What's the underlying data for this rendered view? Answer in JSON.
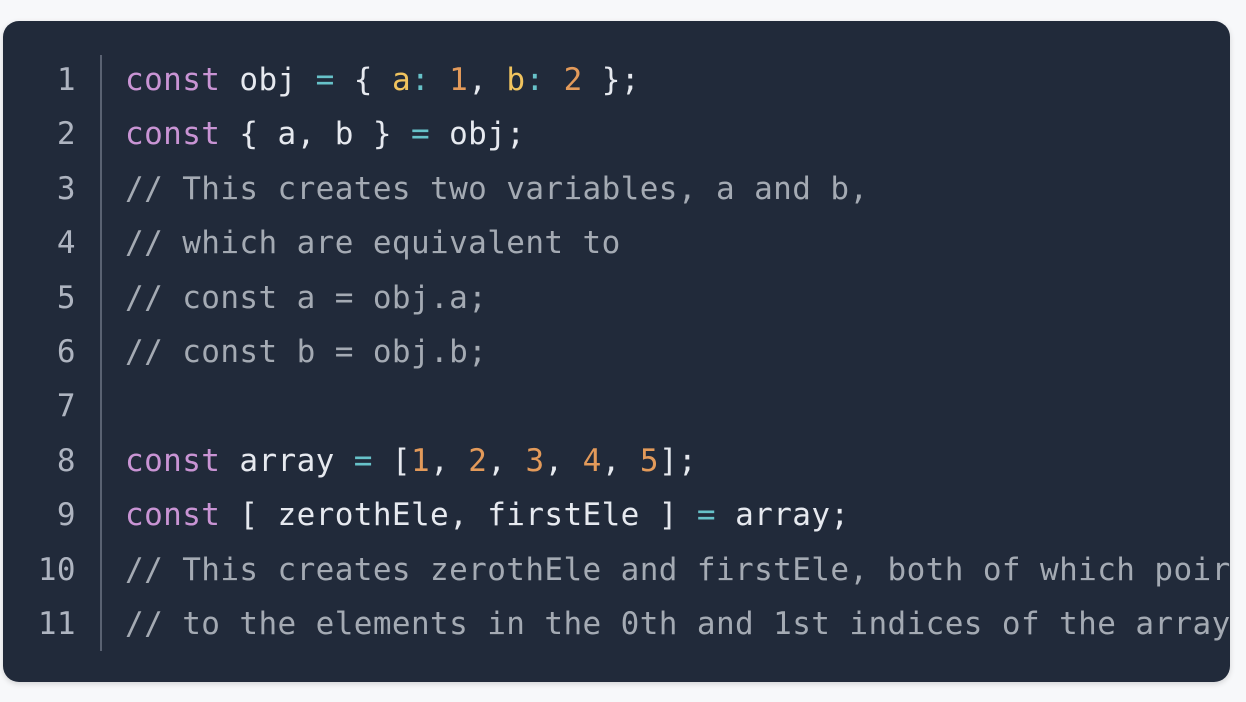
{
  "code_block": {
    "language": "javascript",
    "colors": {
      "background": "#212a3a",
      "keyword": "#c994d4",
      "operator": "#67c2c9",
      "number": "#e39a5a",
      "property": "#f0c35e",
      "comment": "#a4aab3",
      "text": "#e6e9ef",
      "line_number": "#aeb4c0"
    },
    "lines": [
      {
        "number": "1",
        "tokens": [
          {
            "t": "const",
            "c": "kw"
          },
          {
            "t": " obj ",
            "c": "pl"
          },
          {
            "t": "=",
            "c": "op"
          },
          {
            "t": " { ",
            "c": "pl"
          },
          {
            "t": "a",
            "c": "prop"
          },
          {
            "t": ":",
            "c": "op"
          },
          {
            "t": " ",
            "c": "pl"
          },
          {
            "t": "1",
            "c": "num"
          },
          {
            "t": ", ",
            "c": "pl"
          },
          {
            "t": "b",
            "c": "prop"
          },
          {
            "t": ":",
            "c": "op"
          },
          {
            "t": " ",
            "c": "pl"
          },
          {
            "t": "2",
            "c": "num"
          },
          {
            "t": " };",
            "c": "pl"
          }
        ]
      },
      {
        "number": "2",
        "tokens": [
          {
            "t": "const",
            "c": "kw"
          },
          {
            "t": " { a, b } ",
            "c": "pl"
          },
          {
            "t": "=",
            "c": "op"
          },
          {
            "t": " obj;",
            "c": "pl"
          }
        ]
      },
      {
        "number": "3",
        "tokens": [
          {
            "t": "// This creates two variables, a and b,",
            "c": "cm"
          }
        ]
      },
      {
        "number": "4",
        "tokens": [
          {
            "t": "// which are equivalent to",
            "c": "cm"
          }
        ]
      },
      {
        "number": "5",
        "tokens": [
          {
            "t": "// const a = obj.a;",
            "c": "cm"
          }
        ]
      },
      {
        "number": "6",
        "tokens": [
          {
            "t": "// const b = obj.b;",
            "c": "cm"
          }
        ]
      },
      {
        "number": "7",
        "tokens": []
      },
      {
        "number": "8",
        "tokens": [
          {
            "t": "const",
            "c": "kw"
          },
          {
            "t": " array ",
            "c": "pl"
          },
          {
            "t": "=",
            "c": "op"
          },
          {
            "t": " [",
            "c": "pl"
          },
          {
            "t": "1",
            "c": "num"
          },
          {
            "t": ", ",
            "c": "pl"
          },
          {
            "t": "2",
            "c": "num"
          },
          {
            "t": ", ",
            "c": "pl"
          },
          {
            "t": "3",
            "c": "num"
          },
          {
            "t": ", ",
            "c": "pl"
          },
          {
            "t": "4",
            "c": "num"
          },
          {
            "t": ", ",
            "c": "pl"
          },
          {
            "t": "5",
            "c": "num"
          },
          {
            "t": "];",
            "c": "pl"
          }
        ]
      },
      {
        "number": "9",
        "tokens": [
          {
            "t": "const",
            "c": "kw"
          },
          {
            "t": " [ zerothEle, firstEle ] ",
            "c": "pl"
          },
          {
            "t": "=",
            "c": "op"
          },
          {
            "t": " array;",
            "c": "pl"
          }
        ]
      },
      {
        "number": "10",
        "tokens": [
          {
            "t": "// This creates zerothEle and firstEle, both of which poir",
            "c": "cm"
          }
        ]
      },
      {
        "number": "11",
        "tokens": [
          {
            "t": "// to the elements in the 0th and 1st indices of the array",
            "c": "cm"
          }
        ]
      }
    ]
  }
}
